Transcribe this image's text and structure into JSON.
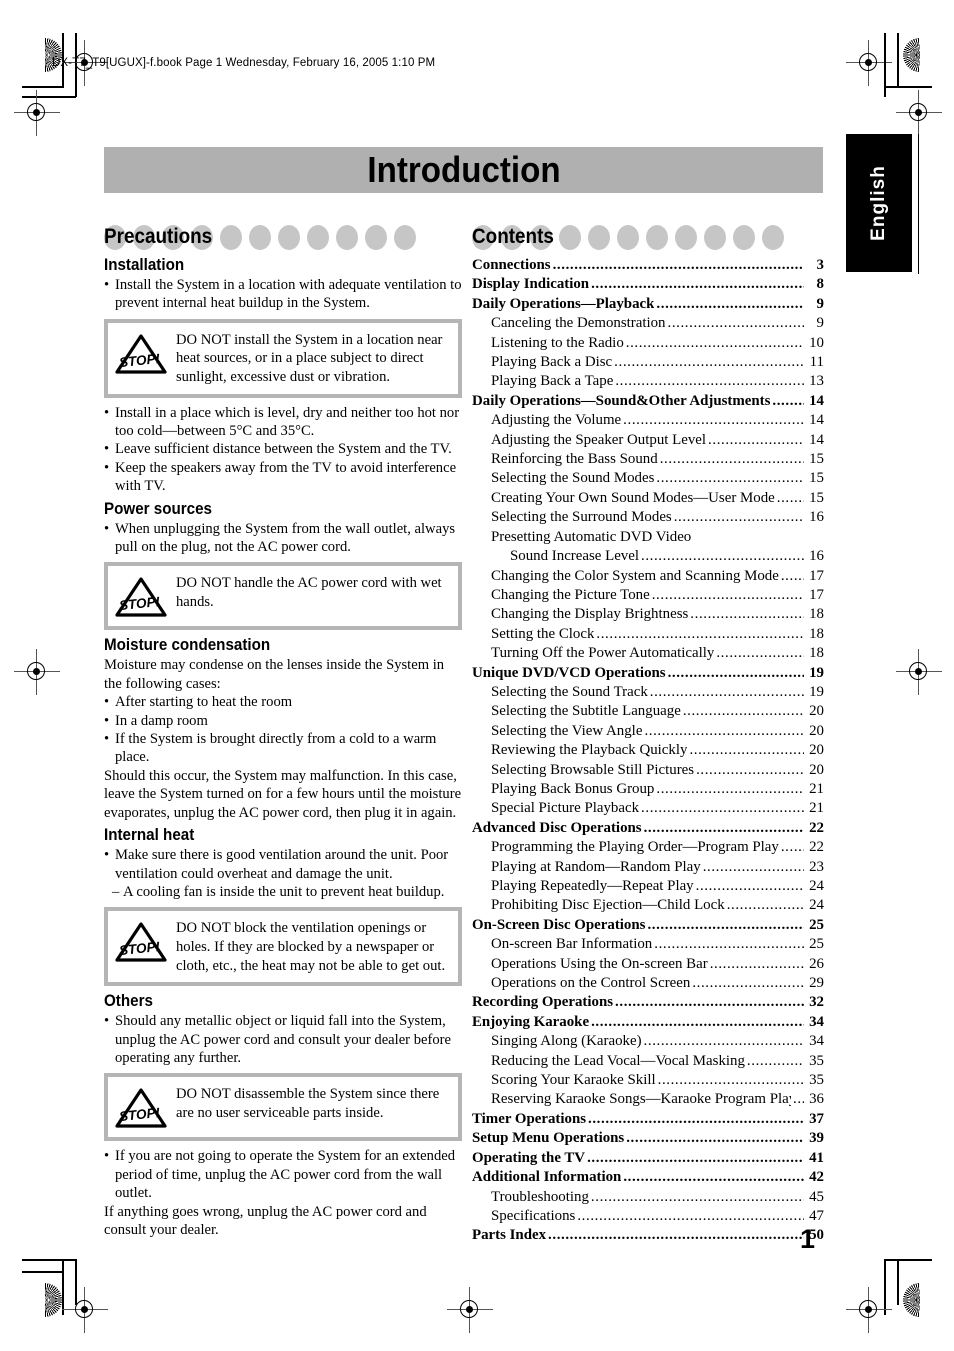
{
  "file_header": "DX-T7_T9[UGUX]-f.book  Page 1  Wednesday, February 16, 2005  1:10 PM",
  "banner": {
    "title": "Introduction"
  },
  "language_tab": {
    "label": "English"
  },
  "folio": "1",
  "left_column": {
    "heading": "Precautions",
    "sections": [
      {
        "heading": "Installation",
        "bullets": [
          "Install the System in a location with adequate ventilation to prevent internal heat buildup in the System."
        ],
        "warning": "DO NOT install the System in a location near heat sources, or in a place subject to direct sunlight, excessive dust or vibration.",
        "bullets_after": [
          "Install in a place which is level, dry and neither too hot nor too cold—between 5°C and 35°C.",
          "Leave sufficient distance between the System and the TV.",
          "Keep the speakers away from the TV to avoid interference with TV."
        ]
      },
      {
        "heading": "Power sources",
        "bullets": [
          "When unplugging the System from the wall outlet, always pull on the plug, not the AC power cord."
        ],
        "warning": "DO NOT handle the AC power cord with wet hands."
      },
      {
        "heading": "Moisture condensation",
        "intro": "Moisture may condense on the lenses inside the System in the following cases:",
        "bullets": [
          "After starting to heat the room",
          "In a damp room",
          "If the System is brought directly from a cold to a warm place."
        ],
        "outro": "Should this occur, the System may malfunction. In this case, leave the System turned on for a few hours until the moisture evaporates, unplug the AC power cord, then plug it in again."
      },
      {
        "heading": "Internal heat",
        "bullets": [
          "Make sure there is good ventilation around the unit. Poor ventilation could overheat and damage the unit."
        ],
        "sub_bullets": [
          "A cooling fan is inside the unit to prevent heat buildup."
        ],
        "warning": "DO NOT block the ventilation openings or holes. If they are blocked by a newspaper or cloth, etc., the heat may not be able to get out."
      },
      {
        "heading": "Others",
        "bullets": [
          "Should any metallic object or liquid fall into the System, unplug the AC power cord and consult your dealer before operating any further."
        ],
        "warning": "DO NOT disassemble the System since there are no user serviceable parts inside.",
        "bullets_after": [
          "If you are not going to operate the System for an extended period of time, unplug the AC power cord from the wall outlet."
        ],
        "outro": "If anything goes wrong, unplug the AC power cord and consult your dealer."
      }
    ],
    "stop_icon_label": "STOP!"
  },
  "right_column": {
    "heading": "Contents",
    "entries": [
      {
        "level": 1,
        "label": "Connections",
        "page": "3"
      },
      {
        "level": 1,
        "label": "Display Indication",
        "page": "8"
      },
      {
        "level": 1,
        "label": "Daily Operations—Playback",
        "page": "9"
      },
      {
        "level": 2,
        "label": "Canceling the Demonstration",
        "page": "9"
      },
      {
        "level": 2,
        "label": "Listening to the Radio",
        "page": "10"
      },
      {
        "level": 2,
        "label": "Playing Back a Disc",
        "page": "11"
      },
      {
        "level": 2,
        "label": "Playing Back a Tape",
        "page": "13"
      },
      {
        "level": 1,
        "label": "Daily Operations—Sound&Other Adjustments",
        "page": "14"
      },
      {
        "level": 2,
        "label": "Adjusting the Volume",
        "page": "14"
      },
      {
        "level": 2,
        "label": "Adjusting the Speaker Output Level",
        "page": "14"
      },
      {
        "level": 2,
        "label": "Reinforcing the Bass Sound",
        "page": "15"
      },
      {
        "level": 2,
        "label": "Selecting the Sound Modes",
        "page": "15"
      },
      {
        "level": 2,
        "label": "Creating Your Own Sound Modes—User Mode",
        "page": "15"
      },
      {
        "level": 2,
        "label": "Selecting the Surround Modes",
        "page": "16"
      },
      {
        "level": 2,
        "label": "Presetting Automatic DVD Video",
        "page": "",
        "noleader": true
      },
      {
        "level": 3,
        "label": "Sound Increase Level",
        "page": "16"
      },
      {
        "level": 2,
        "label": "Changing the Color System and Scanning Mode",
        "page": "17"
      },
      {
        "level": 2,
        "label": "Changing the Picture Tone",
        "page": "17"
      },
      {
        "level": 2,
        "label": "Changing the Display Brightness",
        "page": "18"
      },
      {
        "level": 2,
        "label": "Setting the Clock",
        "page": "18"
      },
      {
        "level": 2,
        "label": "Turning Off the Power Automatically",
        "page": "18"
      },
      {
        "level": 1,
        "label": "Unique DVD/VCD Operations",
        "page": "19"
      },
      {
        "level": 2,
        "label": "Selecting the Sound Track",
        "page": "19"
      },
      {
        "level": 2,
        "label": "Selecting the Subtitle Language",
        "page": "20"
      },
      {
        "level": 2,
        "label": "Selecting the View Angle",
        "page": "20"
      },
      {
        "level": 2,
        "label": "Reviewing the Playback Quickly",
        "page": "20"
      },
      {
        "level": 2,
        "label": "Selecting Browsable Still Pictures",
        "page": "20"
      },
      {
        "level": 2,
        "label": "Playing Back Bonus Group",
        "page": "21"
      },
      {
        "level": 2,
        "label": "Special Picture Playback",
        "page": "21"
      },
      {
        "level": 1,
        "label": "Advanced Disc Operations",
        "page": "22"
      },
      {
        "level": 2,
        "label": "Programming the Playing Order—Program Play",
        "page": "22"
      },
      {
        "level": 2,
        "label": "Playing at Random—Random Play",
        "page": "23"
      },
      {
        "level": 2,
        "label": "Playing Repeatedly—Repeat Play",
        "page": "24"
      },
      {
        "level": 2,
        "label": "Prohibiting Disc Ejection—Child Lock",
        "page": "24"
      },
      {
        "level": 1,
        "label": "On-Screen Disc Operations",
        "page": "25"
      },
      {
        "level": 2,
        "label": "On-screen Bar Information",
        "page": "25"
      },
      {
        "level": 2,
        "label": "Operations Using the On-screen Bar",
        "page": "26"
      },
      {
        "level": 2,
        "label": "Operations on the Control Screen",
        "page": "29"
      },
      {
        "level": 1,
        "label": "Recording Operations",
        "page": "32"
      },
      {
        "level": 1,
        "label": "Enjoying Karaoke",
        "page": "34"
      },
      {
        "level": 2,
        "label": "Singing Along (Karaoke)",
        "page": "34"
      },
      {
        "level": 2,
        "label": "Reducing the Lead Vocal—Vocal Masking",
        "page": "35"
      },
      {
        "level": 2,
        "label": "Scoring Your Karaoke Skill",
        "page": "35"
      },
      {
        "level": 2,
        "label": "Reserving Karaoke Songs—Karaoke Program Play",
        "page": "36"
      },
      {
        "level": 1,
        "label": "Timer Operations",
        "page": "37"
      },
      {
        "level": 1,
        "label": "Setup Menu Operations",
        "page": "39"
      },
      {
        "level": 1,
        "label": "Operating the TV",
        "page": "41"
      },
      {
        "level": 1,
        "label": "Additional Information",
        "page": "42"
      },
      {
        "level": 2,
        "label": "Troubleshooting",
        "page": "45"
      },
      {
        "level": 2,
        "label": "Specifications",
        "page": "47"
      },
      {
        "level": 1,
        "label": "Parts Index",
        "page": "50"
      }
    ]
  },
  "colors": {
    "banner_gray": "#b0b0b0",
    "circle_gray": "#c6c6c6",
    "warn_border_gray": "#b5b5b5",
    "tab_black": "#000000"
  }
}
